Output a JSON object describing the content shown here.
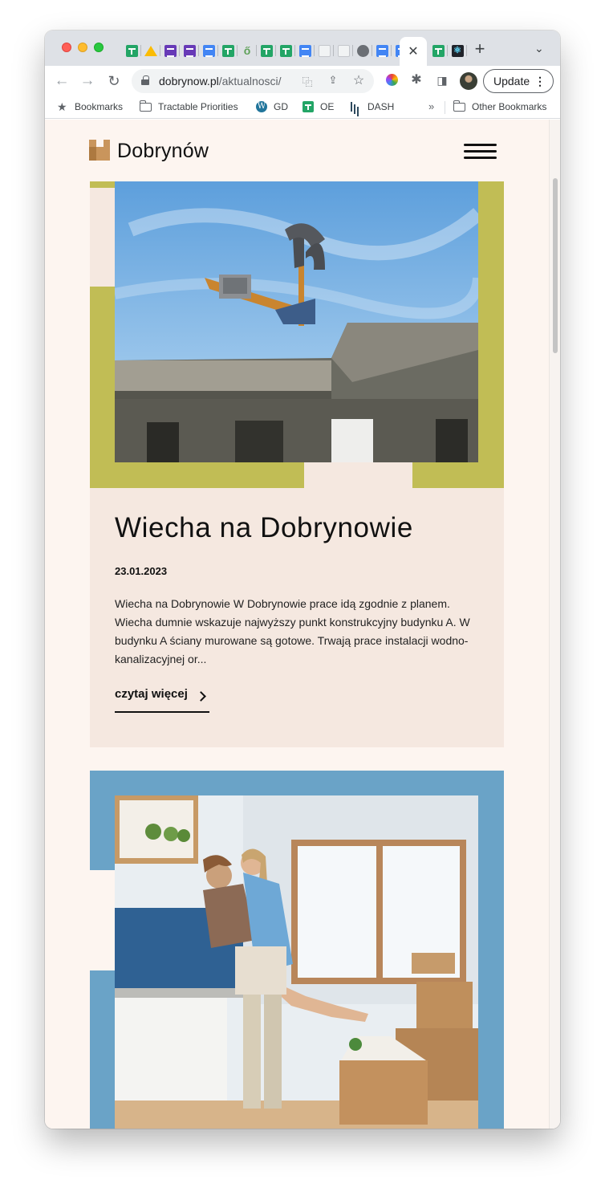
{
  "browser": {
    "active_tab_close": "✕",
    "new_tab": "+",
    "tab_search": "⌄",
    "url_domain": "dobrynow.pl",
    "url_path": "/aktualnosci/",
    "update_label": "Update",
    "menu_dots": "⋮",
    "bookmarks": [
      {
        "label": "Bookmarks",
        "icon": "star-icon"
      },
      {
        "label": "Tractable Priorities",
        "icon": "folder-icon"
      },
      {
        "label": "GD",
        "icon": "wordpress-icon"
      },
      {
        "label": "OE",
        "icon": "sheets-icon"
      },
      {
        "label": "DASH",
        "icon": "dash-icon"
      }
    ],
    "bookmarks_more": "»",
    "other_bookmarks": "Other Bookmarks"
  },
  "site": {
    "logo_text": "Dobrynów",
    "accent_olive": "#c1bd55",
    "accent_blue": "#6aa3c7",
    "background": "#fdf5f0",
    "card_background": "#f5e8e0"
  },
  "articles": [
    {
      "title": "Wiecha na Dobrynowie",
      "date": "23.01.2023",
      "excerpt": "Wiecha na Dobrynowie W Dobrynowie prace idą zgodnie z planem. Wiecha dumnie wskazuje najwyższy punkt konstrukcyjny budynku A. W budynku A ściany murowane są gotowe. Trwają prace instalacji wodno-kanalizacyjnej or...",
      "read_more": "czytaj więcej",
      "image": "construction-crane-photo"
    },
    {
      "image": "couple-moving-photo"
    }
  ]
}
